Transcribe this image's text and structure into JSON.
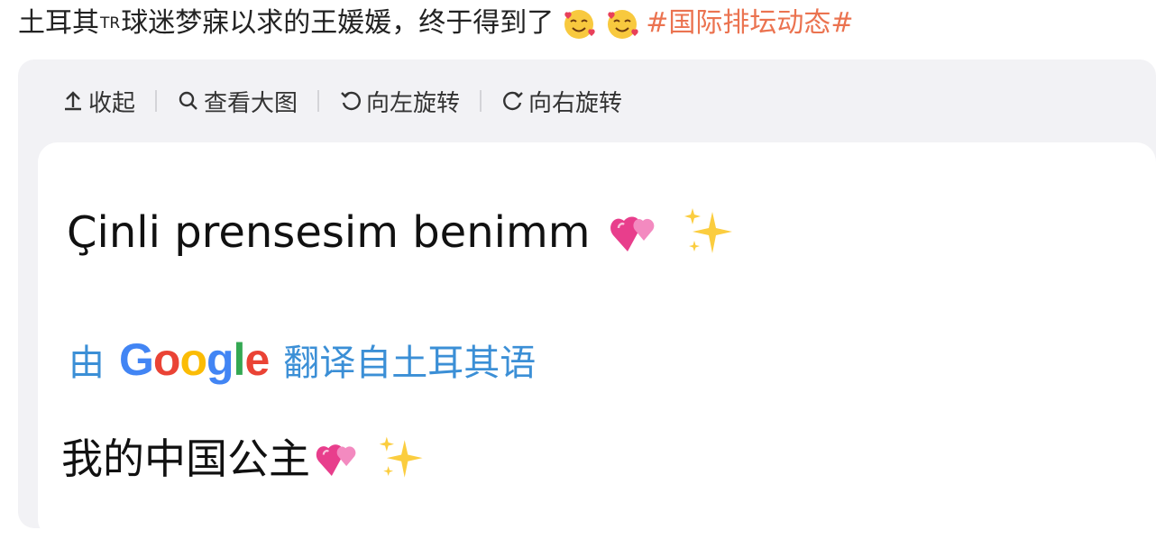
{
  "post": {
    "text_before": "土耳其",
    "text_tr": "TR",
    "text_after": "球迷梦寐以求的王媛媛，终于得到了",
    "emojis": [
      "smiling-face-with-hearts",
      "smiling-face-with-hearts"
    ],
    "hashtag": "#国际排坛动态#",
    "hashtag_color": "#eb7350"
  },
  "toolbar": {
    "collapse": "收起",
    "view_large": "查看大图",
    "rotate_left": "向左旋转",
    "rotate_right": "向右旋转"
  },
  "card": {
    "original_text": "Çinli prensesim benimm",
    "original_emojis": [
      "two-hearts",
      "sparkles"
    ],
    "attribution_prefix": "由",
    "attribution_brand": "Google",
    "attribution_suffix": "翻译自土耳其语",
    "attribution_color": "#3b8fd6",
    "translated_text": "我的中国公主",
    "translated_emojis": [
      "two-hearts",
      "sparkles"
    ]
  }
}
